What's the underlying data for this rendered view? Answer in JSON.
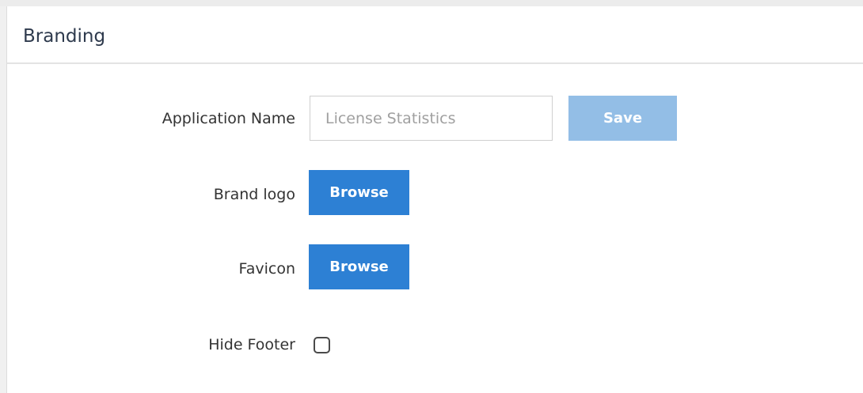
{
  "panel": {
    "title": "Branding"
  },
  "form": {
    "application_name": {
      "label": "Application Name",
      "value": "",
      "placeholder": "License Statistics",
      "save_label": "Save"
    },
    "brand_logo": {
      "label": "Brand logo",
      "browse_label": "Browse"
    },
    "favicon": {
      "label": "Favicon",
      "browse_label": "Browse"
    },
    "hide_footer": {
      "label": "Hide Footer",
      "checked": false
    }
  },
  "colors": {
    "primary": "#2d80d4",
    "primary_disabled": "#93bee6",
    "title_text": "#2e3a4d"
  }
}
